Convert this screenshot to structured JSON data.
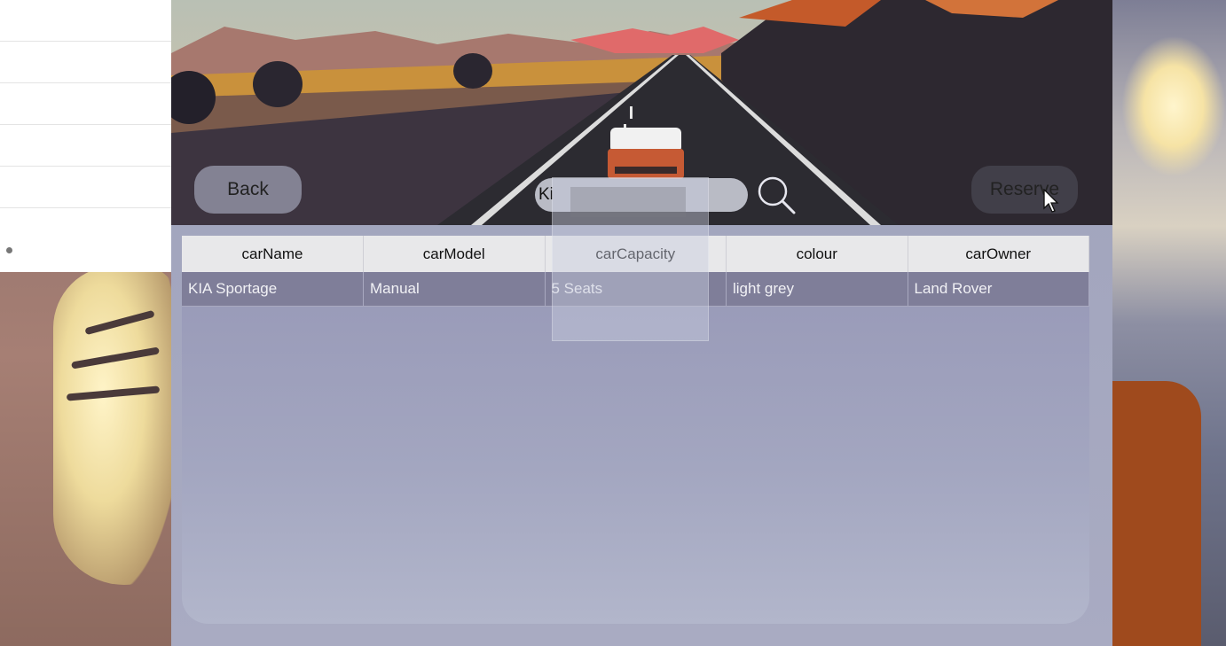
{
  "app": {
    "back_label": "Back",
    "reserve_label": "Reserve",
    "search": {
      "value": "Ki",
      "placeholder": ""
    },
    "search_icon": "search-icon"
  },
  "table": {
    "headers": [
      "carName",
      "carModel",
      "carCapacity",
      "colour",
      "carOwner"
    ],
    "rows": [
      [
        "KIA Sportage",
        "Manual",
        "5 Seats",
        "light grey",
        "Land Rover"
      ]
    ]
  },
  "colors": {
    "header_bg": "#e8e8ea",
    "row_bg": "#7f7e99",
    "panel_bg": "#a3a6c0"
  }
}
